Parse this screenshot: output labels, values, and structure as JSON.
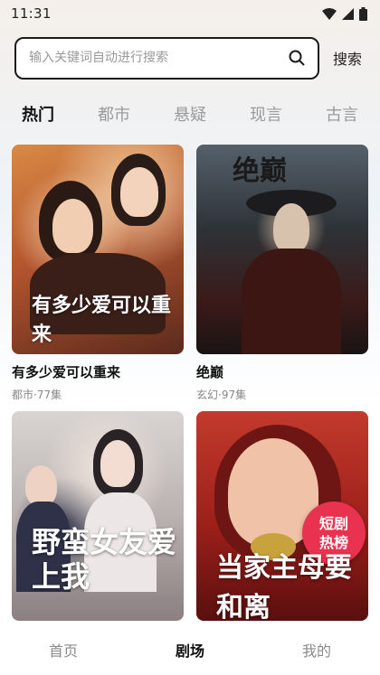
{
  "status": {
    "time": "11:31"
  },
  "search": {
    "placeholder": "输入关键词自动进行搜索",
    "button_label": "搜索"
  },
  "tabs": [
    {
      "label": "热门",
      "active": true
    },
    {
      "label": "都市",
      "active": false
    },
    {
      "label": "悬疑",
      "active": false
    },
    {
      "label": "现言",
      "active": false
    },
    {
      "label": "古言",
      "active": false
    }
  ],
  "dramas": [
    {
      "title": "有多少爱可以重来",
      "meta": "都市·77集",
      "poster_art": "有多少爱可以重来"
    },
    {
      "title": "绝巅",
      "meta": "玄幻·97集",
      "poster_art": "绝巅"
    },
    {
      "title": "野蛮女友爱上我",
      "meta": "",
      "poster_art": "野蛮女友爱上我"
    },
    {
      "title": "当家主母要和离",
      "meta": "",
      "poster_art": "当家主母要和离"
    }
  ],
  "badge": {
    "line1": "短剧",
    "line2": "热榜"
  },
  "nav": [
    {
      "label": "首页",
      "active": false
    },
    {
      "label": "剧场",
      "active": true
    },
    {
      "label": "我的",
      "active": false
    }
  ],
  "colors": {
    "badge": "#e8324f",
    "active_text": "#111111",
    "inactive_text": "#9a9a9a"
  }
}
